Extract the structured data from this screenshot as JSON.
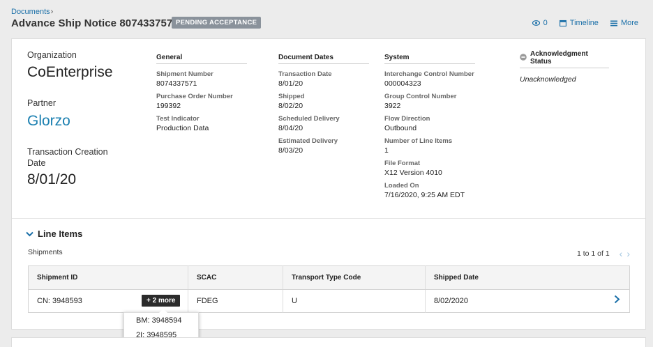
{
  "breadcrumb": {
    "label": "Documents",
    "separator": "›"
  },
  "header": {
    "title": "Advance Ship Notice 8074337571",
    "status": "PENDING ACCEPTANCE",
    "actions": {
      "views_count": "0",
      "timeline": "Timeline",
      "more": "More"
    }
  },
  "summary": {
    "organization_label": "Organization",
    "organization": "CoEnterprise",
    "partner_label": "Partner",
    "partner": "Glorzo",
    "creation_label": "Transaction Creation Date",
    "creation_date": "8/01/20"
  },
  "general": {
    "heading": "General",
    "fields": [
      {
        "label": "Shipment Number",
        "value": "8074337571"
      },
      {
        "label": "Purchase Order Number",
        "value": "199392"
      },
      {
        "label": "Test Indicator",
        "value": "Production Data"
      }
    ]
  },
  "document_dates": {
    "heading": "Document Dates",
    "fields": [
      {
        "label": "Transaction Date",
        "value": "8/01/20"
      },
      {
        "label": "Shipped",
        "value": "8/02/20"
      },
      {
        "label": "Scheduled Delivery",
        "value": "8/04/20"
      },
      {
        "label": "Estimated Delivery",
        "value": "8/03/20"
      }
    ]
  },
  "system": {
    "heading": "System",
    "fields": [
      {
        "label": "Interchange Control Number",
        "value": "000004323"
      },
      {
        "label": "Group Control Number",
        "value": "3922"
      },
      {
        "label": "Flow Direction",
        "value": "Outbound"
      },
      {
        "label": "Number of Line Items",
        "value": "1"
      },
      {
        "label": "File Format",
        "value": "X12 Version 4010"
      },
      {
        "label": "Loaded On",
        "value": "7/16/2020, 9:25 AM EDT"
      }
    ]
  },
  "acknowledgment": {
    "heading": "Acknowledgment Status",
    "value": "Unacknowledged"
  },
  "line_items": {
    "title": "Line Items",
    "subsection": "Shipments",
    "pagination": "1 to 1 of 1",
    "columns": [
      "Shipment ID",
      "SCAC",
      "Transport Type Code",
      "Shipped Date"
    ],
    "rows": [
      {
        "shipment_id": "CN: 3948593",
        "scac": "FDEG",
        "transport": "U",
        "shipped": "8/02/2020",
        "more": "+ 2 more"
      }
    ],
    "popover": [
      "BM: 3948594",
      "2I: 3948595"
    ]
  },
  "colors": {
    "link": "#1a6fa8",
    "partner": "#1a7fb0",
    "badge": "#8a929b"
  },
  "icons": [
    "eye-icon",
    "calendar-icon",
    "menu-icon",
    "chevron-down-icon",
    "chevron-left-icon",
    "chevron-right-icon",
    "minus-circle-icon"
  ]
}
